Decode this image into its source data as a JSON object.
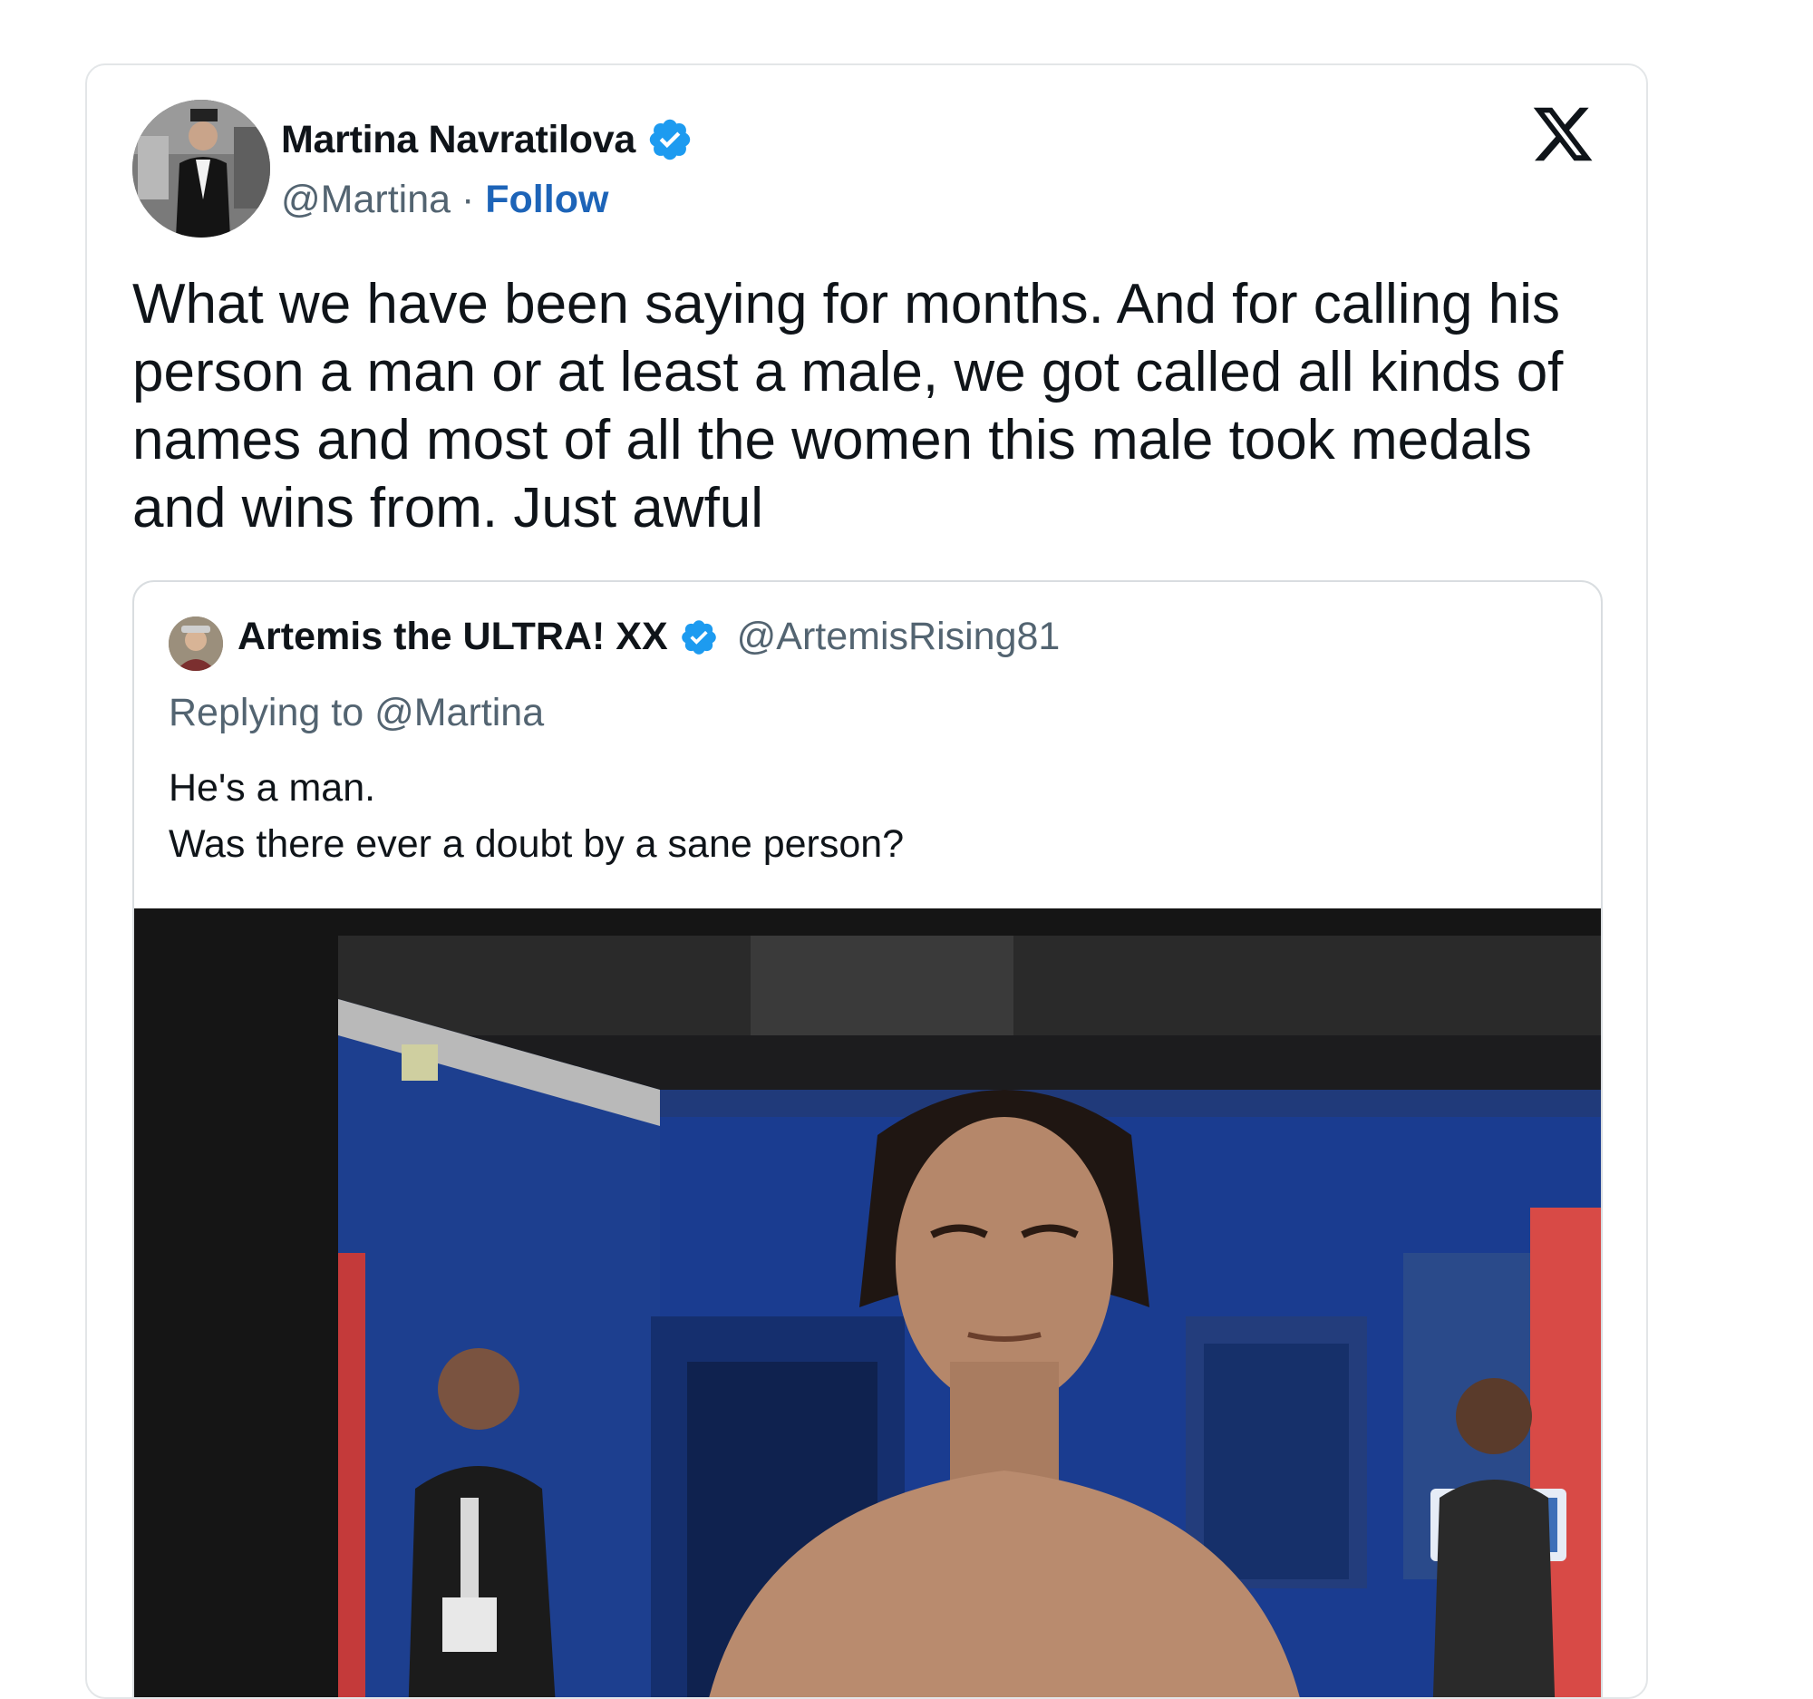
{
  "tweet": {
    "author": {
      "name": "Martina Navratilova",
      "handle": "@Martina",
      "separator": " · ",
      "follow_label": "Follow"
    },
    "text": "What we have been saying for months. And for calling his person a man or at least a male, we got called all kinds of names and most of all the women this male took medals and wins from. Just awful",
    "quoted": {
      "author": {
        "name": "Artemis the ULTRA! XX",
        "handle": "@ArtemisRising81"
      },
      "replying_to": "Replying to @Martina",
      "line1": "He's a man.",
      "line2": "Was there ever a doubt by a sane person?"
    }
  },
  "colors": {
    "accent": "#1d9bf0",
    "follow": "#1d64b8",
    "secondary_text": "#536471",
    "border": "#e3e6e8"
  },
  "icons": {
    "brand": "x-logo-icon",
    "verified": "verified-badge-icon"
  }
}
